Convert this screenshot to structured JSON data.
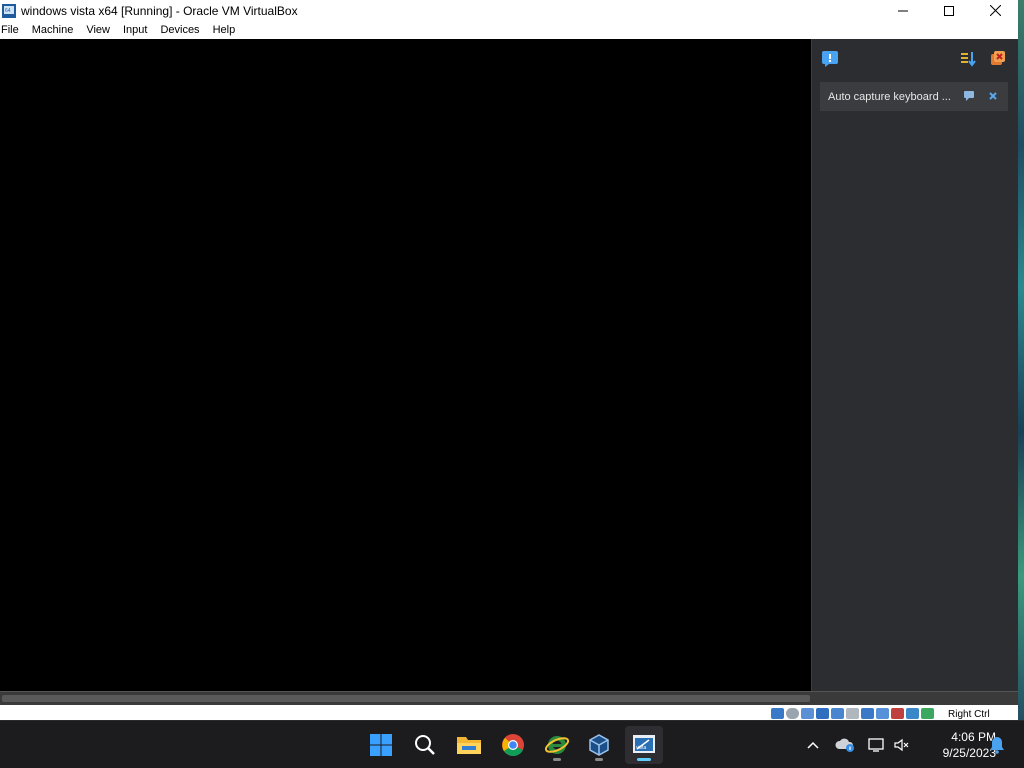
{
  "window": {
    "title": "windows vista x64 [Running] - Oracle VM VirtualBox"
  },
  "menu": {
    "items": [
      "File",
      "Machine",
      "View",
      "Input",
      "Devices",
      "Help"
    ]
  },
  "notification_center": {
    "cards": [
      {
        "text": "Auto capture keyboard ..."
      }
    ]
  },
  "statusbar": {
    "host_key": "Right Ctrl"
  },
  "taskbar": {
    "apps": [
      {
        "name": "start-button",
        "icon": "windows-logo-icon"
      },
      {
        "name": "search-button",
        "icon": "search-icon"
      },
      {
        "name": "file-explorer-button",
        "icon": "folder-icon"
      },
      {
        "name": "chrome-button",
        "icon": "chrome-icon"
      },
      {
        "name": "edge-button",
        "icon": "internet-explorer-icon"
      },
      {
        "name": "virtualbox-button",
        "icon": "virtualbox-cube-icon"
      },
      {
        "name": "vm-window-button",
        "icon": "vista-vm-icon"
      }
    ],
    "clock": {
      "time": "4:06 PM",
      "date": "9/25/2023"
    }
  },
  "colors": {
    "taskbar_bg": "#1c1c1e",
    "panel_bg": "#2b2d31",
    "accent": "#60cdff"
  }
}
